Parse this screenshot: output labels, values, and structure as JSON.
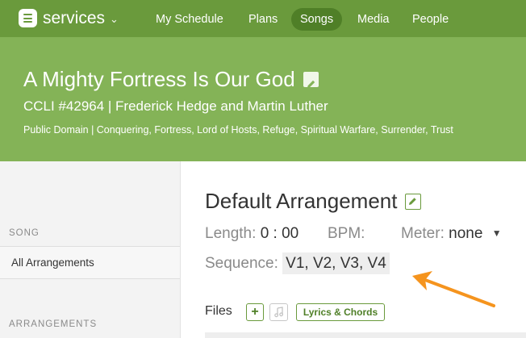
{
  "app": {
    "name": "services"
  },
  "nav": {
    "items": [
      "My Schedule",
      "Plans",
      "Songs",
      "Media",
      "People"
    ],
    "active": "Songs"
  },
  "song": {
    "title": "A Mighty Fortress Is Our God",
    "subtitle": "CCLI #42964 | Frederick Hedge and Martin Luther",
    "tags": "Public Domain | Conquering, Fortress, Lord of Hosts, Refuge, Spiritual Warfare, Surrender, Trust"
  },
  "sidebar": {
    "song_label": "SONG",
    "all_arrangements": "All Arrangements",
    "arrangements_label": "ARRANGEMENTS"
  },
  "arrangement": {
    "title": "Default Arrangement",
    "length_label": "Length:",
    "length_value": "0 : 00",
    "bpm_label": "BPM:",
    "meter_label": "Meter:",
    "meter_value": "none",
    "sequence_label": "Sequence:",
    "sequence_value": "V1, V2, V3, V4"
  },
  "files": {
    "label": "Files",
    "add_symbol": "+",
    "lyrics_chords": "Lyrics & Chords"
  },
  "colors": {
    "nav_bg": "#6a9a3c",
    "header_bg": "#84b357",
    "nav_active": "#4f7f27",
    "annotation_arrow": "#f5941e"
  },
  "icons": [
    "services-logo-icon",
    "chevron-down-icon",
    "pencil-edit-icon",
    "caret-down-icon",
    "plus-icon",
    "music-note-icon",
    "arrow-annotation-icon"
  ]
}
